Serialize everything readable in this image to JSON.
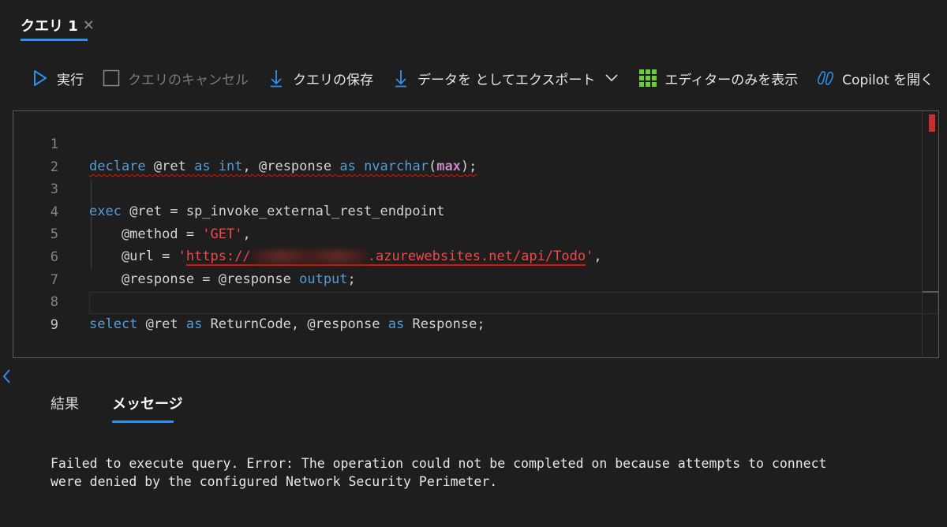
{
  "tab": {
    "title": "クエリ 1",
    "close_glyph": "✕"
  },
  "toolbar": {
    "run_label": "実行",
    "cancel_label": "クエリのキャンセル",
    "save_label": "クエリの保存",
    "export_label": "データを としてエクスポート",
    "editor_only_label": "エディターのみを表示",
    "copilot_label": "Copilot を開く"
  },
  "editor": {
    "line_numbers": [
      "1",
      "2",
      "3",
      "4",
      "5",
      "6",
      "7",
      "8",
      "9"
    ],
    "line1": {
      "declare": "declare",
      "ret": " @ret ",
      "as1": "as",
      "int": " int",
      "comma": ", @response ",
      "as2": "as",
      "nvarchar": " nvarchar",
      "open": "(",
      "max": "max",
      "close": ");"
    },
    "line3": {
      "exec": "exec",
      "rest": " @ret = sp_invoke_external_rest_endpoint"
    },
    "line4": {
      "param": "    @method = ",
      "value": "'GET'",
      "comma": ","
    },
    "line5": {
      "param": "    @url = ",
      "quote_open": "'",
      "url_start": "https://",
      "url_end": ".azurewebsites.net/api/Todo",
      "quote_close": "'",
      "comma": ","
    },
    "line6": {
      "param": "    @response = @response ",
      "output": "output",
      "semi": ";"
    },
    "line8": {
      "select": "select",
      "ret": " @ret ",
      "as1": "as",
      "rc": " ReturnCode, @response ",
      "as2": "as",
      "resp": " Response;"
    }
  },
  "results": {
    "tab_results": "結果",
    "tab_messages": "メッセージ",
    "message_text": "Failed to execute query. Error: The operation could not be completed on because attempts to connect\nwere denied by the configured Network Security Perimeter."
  },
  "colors": {
    "accent": "#2f8ff0",
    "keyword": "#569cd6",
    "string": "#f44747",
    "function": "#c586c0",
    "error": "#e51400"
  },
  "icons": [
    "play-icon",
    "checkbox-icon",
    "download-icon",
    "download-icon",
    "chevron-down-icon",
    "grid-icon",
    "copilot-icon",
    "chevron-left-icon"
  ]
}
